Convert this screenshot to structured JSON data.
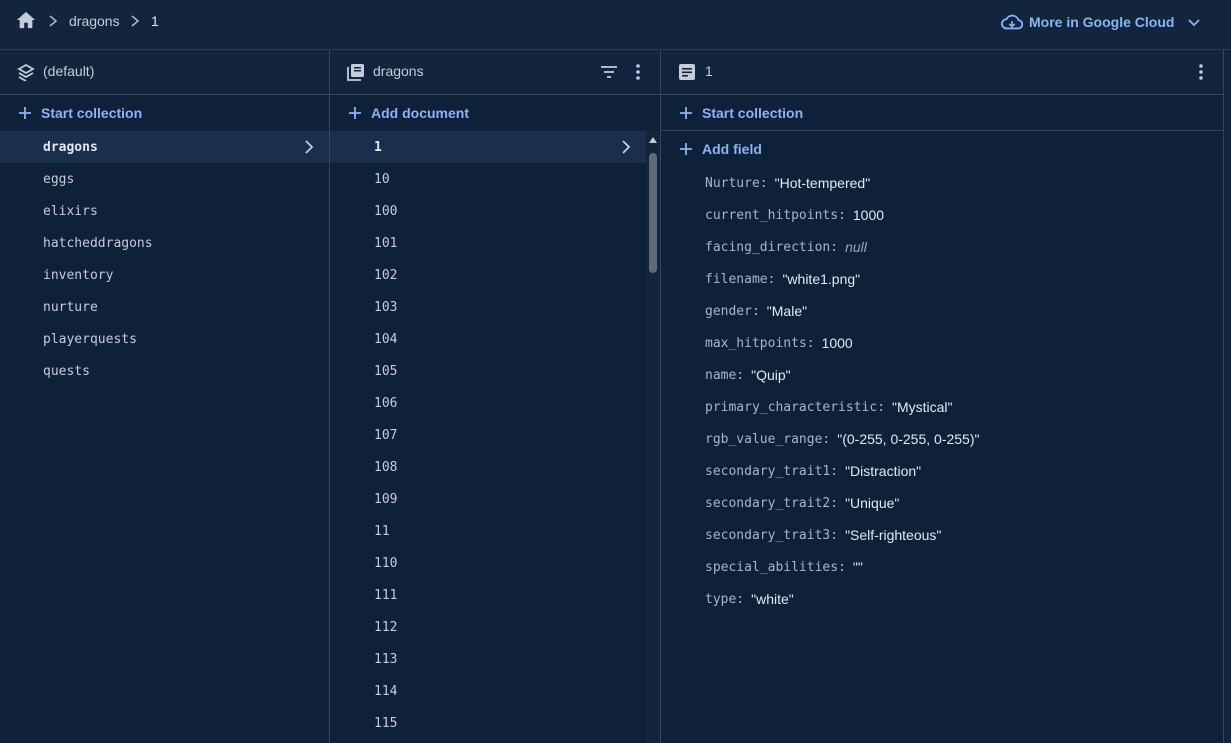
{
  "breadcrumb": {
    "home_icon": "home-icon",
    "items": [
      "dragons",
      "1"
    ]
  },
  "cloud": {
    "label": "More in Google Cloud",
    "icon": "cloud-icon"
  },
  "accent": "#8ab4f8",
  "panel_root": {
    "title": "(default)",
    "icon": "firestore-icon",
    "action": "Start collection",
    "collections": [
      "dragons",
      "eggs",
      "elixirs",
      "hatcheddragons",
      "inventory",
      "nurture",
      "playerquests",
      "quests"
    ],
    "selected": "dragons"
  },
  "panel_collection": {
    "title": "dragons",
    "icon": "collection-icon",
    "action": "Add document",
    "documents": [
      "1",
      "10",
      "100",
      "101",
      "102",
      "103",
      "104",
      "105",
      "106",
      "107",
      "108",
      "109",
      "11",
      "110",
      "111",
      "112",
      "113",
      "114",
      "115"
    ],
    "selected": "1"
  },
  "panel_document": {
    "title": "1",
    "icon": "document-icon",
    "action_collection": "Start collection",
    "action_field": "Add field",
    "fields": [
      {
        "key": "Nurture",
        "value": "\"Hot-tempered\""
      },
      {
        "key": "current_hitpoints",
        "value": "1000"
      },
      {
        "key": "facing_direction",
        "value": "null"
      },
      {
        "key": "filename",
        "value": "\"white1.png\""
      },
      {
        "key": "gender",
        "value": "\"Male\""
      },
      {
        "key": "max_hitpoints",
        "value": "1000"
      },
      {
        "key": "name",
        "value": "\"Quip\""
      },
      {
        "key": "primary_characteristic",
        "value": "\"Mystical\""
      },
      {
        "key": "rgb_value_range",
        "value": "\"(0-255, 0-255, 0-255)\""
      },
      {
        "key": "secondary_trait1",
        "value": "\"Distraction\""
      },
      {
        "key": "secondary_trait2",
        "value": "\"Unique\""
      },
      {
        "key": "secondary_trait3",
        "value": "\"Self-righteous\""
      },
      {
        "key": "special_abilities",
        "value": "\"\""
      },
      {
        "key": "type",
        "value": "\"white\""
      }
    ]
  }
}
